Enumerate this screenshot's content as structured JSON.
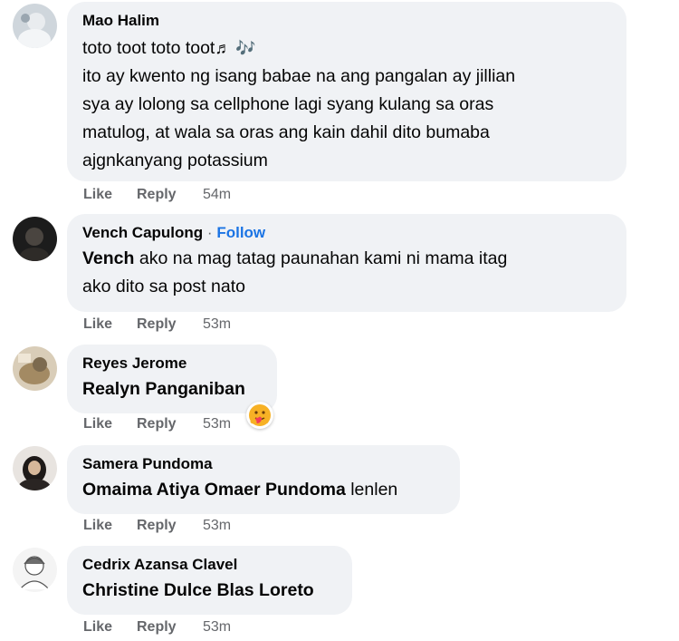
{
  "actions": {
    "like": "Like",
    "reply": "Reply"
  },
  "comments": [
    {
      "author": "Mao Halim",
      "lines": [
        "toto toot toto toot",
        "ito ay kwento ng isang babae na ang pangalan ay jillian",
        "sya ay lolong sa cellphone lagi syang kulang sa oras",
        "matulog, at wala sa oras ang kain dahil dito bumaba",
        "ajgnkanyang potassium"
      ],
      "music_icons": "♬ 🎶",
      "time": "54m"
    },
    {
      "author": "Vench Capulong",
      "separator": "·",
      "follow": "Follow",
      "mention": "Vench",
      "line1_rest": " ako na mag tatag paunahan kami ni mama itag",
      "line2": "ako dito sa post nato",
      "time": "53m"
    },
    {
      "author": "Reyes Jerome",
      "mention": "Realyn Panganiban",
      "time": "53m",
      "reaction": "care-reaction"
    },
    {
      "author": "Samera Pundoma",
      "mention": "Omaima Atiya Omaer Pundoma",
      "rest": " lenlen",
      "time": "53m"
    },
    {
      "author": "Cedrix Azansa Clavel",
      "mention": "Christine Dulce Blas Loreto",
      "time": "53m"
    }
  ],
  "colors": {
    "bubble": "#f0f2f5",
    "follow": "#1b74e4",
    "meta": "#65676b",
    "text": "#050505"
  }
}
